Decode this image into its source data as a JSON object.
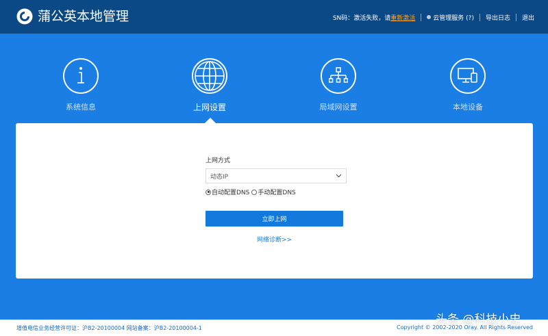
{
  "header": {
    "brand": "蒲公英本地管理",
    "sn_text": "SN码：激活失败，请",
    "reactivate_link": "重新激活",
    "cloud_service": "云管理服务 (?)",
    "export_log": "导出日志",
    "logout": "退出"
  },
  "nav": {
    "items": [
      {
        "label": "系统信息",
        "icon": "info-icon"
      },
      {
        "label": "上网设置",
        "icon": "globe-icon",
        "active": true
      },
      {
        "label": "局域网设置",
        "icon": "network-tree-icon"
      },
      {
        "label": "本地设备",
        "icon": "devices-icon"
      }
    ]
  },
  "form": {
    "label": "上网方式",
    "select_value": "动态IP",
    "radio_auto": "自动配置DNS",
    "radio_manual": "手动配置DNS",
    "submit": "立即上网",
    "diagnose": "网络诊断>>"
  },
  "footer": {
    "license": "增值电信业务经营许可证：沪B2-20100004 网站备案：沪B2-20100004-1",
    "copyright": "Copyright © 2002-2020 Oray. All Rights Reserved"
  },
  "watermark": "头条 @科技小史",
  "colors": {
    "topbar": "#0a4886",
    "background": "#1a7ee4",
    "button": "#1479dd",
    "link_orange": "#ffa52a"
  }
}
